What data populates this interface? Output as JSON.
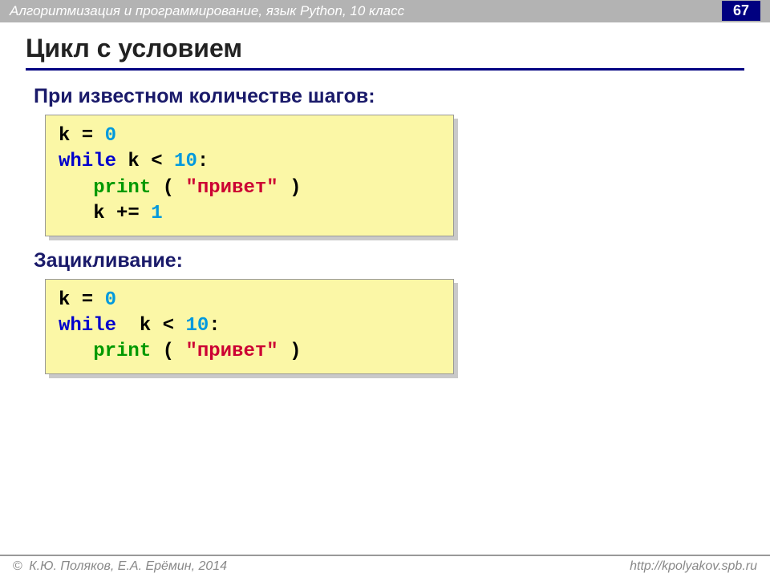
{
  "header": {
    "course_text": "Алгоритмизация и программирование, язык Python, 10 класс",
    "page_number": "67"
  },
  "title": "Цикл с условием",
  "section1": {
    "heading": "При известном количестве шагов:",
    "code": {
      "l1_a": "k",
      "l1_b": " = ",
      "l1_c": "0",
      "l2_a": "while",
      "l2_b": " k",
      "l2_c": " < ",
      "l2_d": "10",
      "l2_e": ":",
      "l3_a": "print",
      "l3_b": " ( ",
      "l3_c": "\"привет\"",
      "l3_d": " )",
      "l4_a": "   k += ",
      "l4_b": "1"
    }
  },
  "section2": {
    "heading": "Зацикливание:",
    "code": {
      "l1_a": "k",
      "l1_b": " = ",
      "l1_c": "0",
      "l2_a": "while",
      "l2_b": "  k",
      "l2_c": " < ",
      "l2_d": "10",
      "l2_e": ":",
      "l3_a": "print",
      "l3_b": " ( ",
      "l3_c": "\"привет\"",
      "l3_d": " )"
    }
  },
  "footer": {
    "copyright_symbol": "©",
    "authors": " К.Ю. Поляков, Е.А. Ерёмин, 2014",
    "url": "http://kpolyakov.spb.ru"
  }
}
